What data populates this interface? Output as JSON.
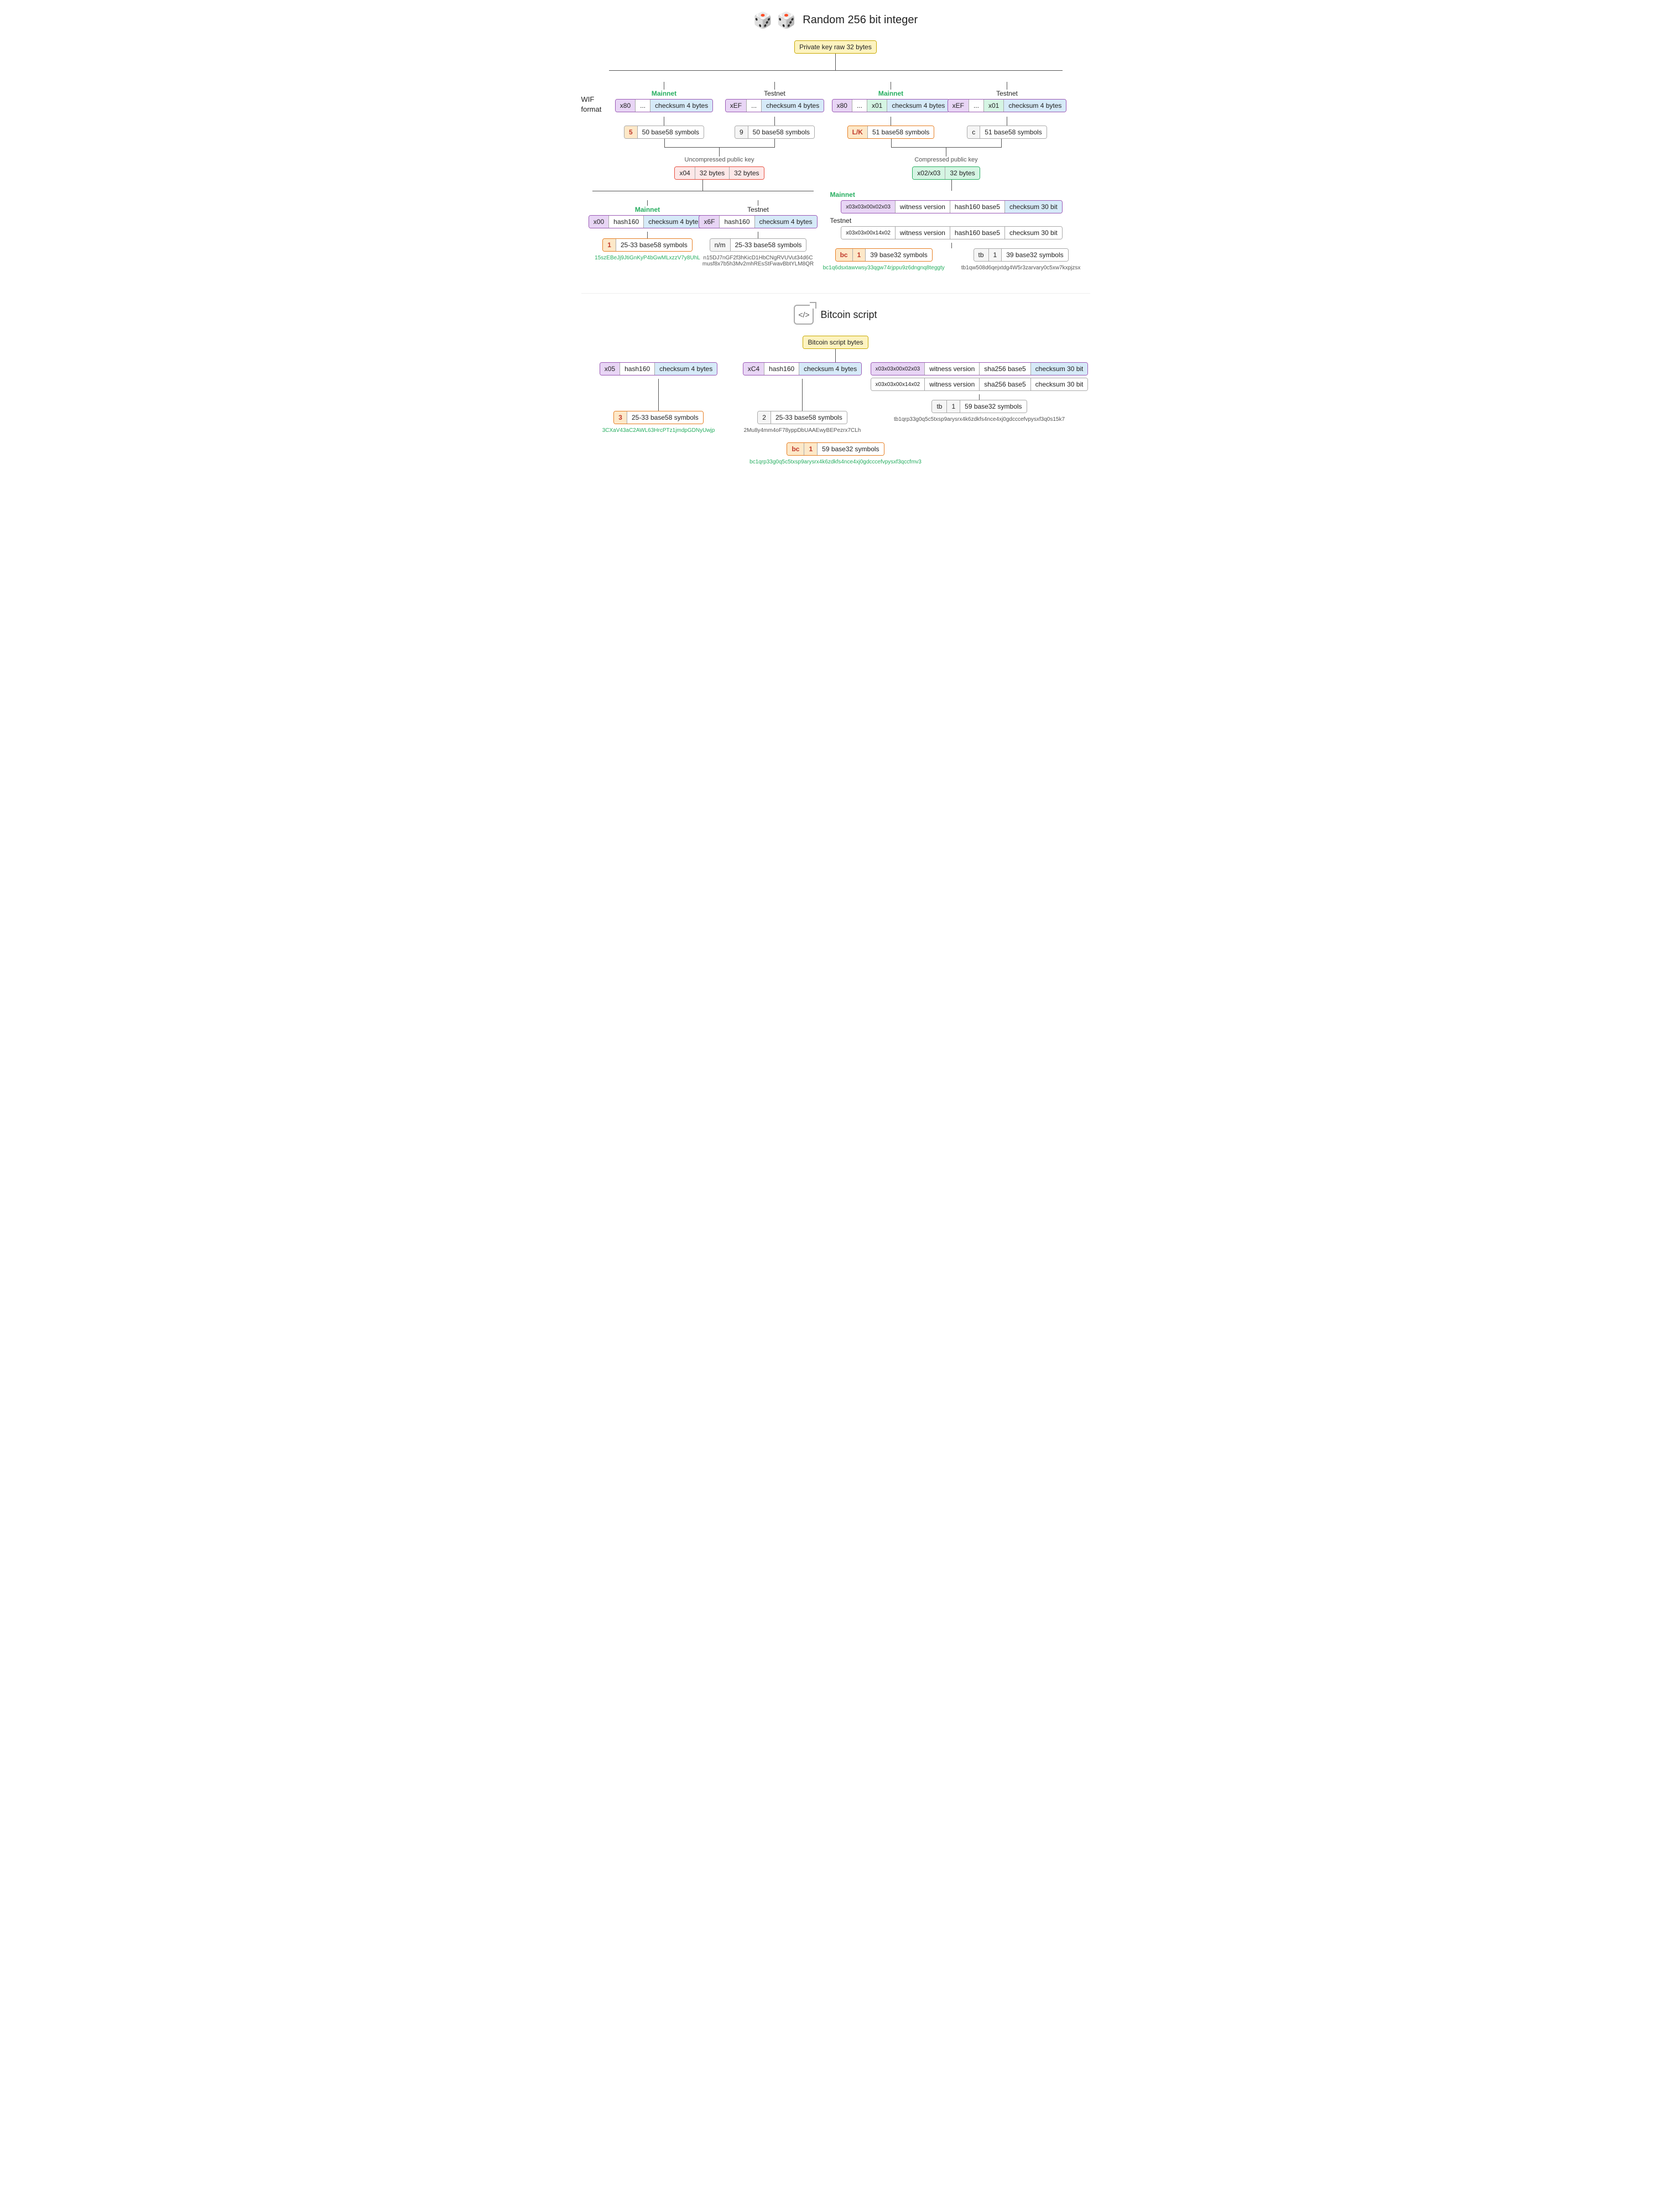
{
  "header": {
    "title": "Random 256 bit integer",
    "dice": "🎲🎲"
  },
  "top_node": {
    "label": "Private key raw 32 bytes"
  },
  "section1_title": "Bitcoin script",
  "section2_title": "Bitcoin script bytes",
  "branches": {
    "mainnet_uncompressed": {
      "net": "Mainnet",
      "bytes": [
        "x80",
        "...",
        "checksum 4 bytes"
      ]
    },
    "testnet_uncompressed": {
      "net": "Testnet",
      "bytes": [
        "xEF",
        "...",
        "checksum 4 bytes"
      ]
    },
    "mainnet_compressed": {
      "net": "Mainnet",
      "bytes": [
        "x80",
        "...",
        "x01",
        "checksum 4 bytes"
      ]
    },
    "testnet_compressed": {
      "net": "Testnet",
      "bytes": [
        "xEF",
        "...",
        "x01",
        "checksum 4 bytes"
      ]
    }
  },
  "wif": {
    "label": "WIF\nformat",
    "mainnet_uncomp": {
      "prefix": "5",
      "desc": "50 base58 symbols"
    },
    "testnet_uncomp": {
      "prefix": "9",
      "desc": "50 base58 symbols"
    },
    "mainnet_comp": {
      "prefix": "L/K",
      "desc": "51 base58 symbols"
    },
    "testnet_comp": {
      "prefix": "c",
      "desc": "51 base58 symbols"
    }
  },
  "pubkeys": {
    "uncompressed": {
      "label": "Uncompressed public key",
      "bytes": [
        "x04",
        "32 bytes",
        "32 bytes"
      ]
    },
    "compressed": {
      "label": "Compressed public key",
      "bytes": [
        "x02/x03",
        "32 bytes"
      ]
    }
  },
  "p2pkh": {
    "mainnet": {
      "net": "Mainnet",
      "bytes": [
        "x00",
        "hash160",
        "checksum 4 bytes"
      ],
      "wif_prefix": "1",
      "wif_desc": "25-33 base58 symbols",
      "address": "15szEBeJj9JtiGnKyP4bGwMLxzzV7y8UhL"
    },
    "testnet": {
      "net": "Testnet",
      "bytes": [
        "x6F",
        "hash160",
        "checksum 4 bytes"
      ],
      "wif_prefix": "n/m",
      "wif_desc": "25-33 base58 symbols",
      "address1": "n15DJ7nGF2f3hKicD1HbCNgRVUVut34d6C",
      "address2": "musf8x7b5h3Mv2mhREsStFwavBbtYLM8QR"
    }
  },
  "bech32": {
    "mainnet": {
      "bytes": [
        "x03x03x00x02x03",
        "witness version",
        "hash160 base5",
        "checksum 30 bit"
      ],
      "prefix": "bc",
      "num": "1",
      "desc": "39 base32 symbols",
      "address": "bc1q6dsxtawvwsy33qgw74rjppu9z6dngnq8teggty"
    },
    "testnet": {
      "bytes": [
        "x03x03x00x14x02",
        "witness version",
        "hash160 base5",
        "checksum 30 bit"
      ],
      "prefix": "tb",
      "num": "1",
      "desc": "39 base32 symbols",
      "address": "tb1qw508d6qejxtdg4W5r3zarvary0c5xw7kxpjzsx"
    }
  },
  "script_section": {
    "p2sh_mainnet": {
      "bytes": [
        "x05",
        "hash160",
        "checksum 4 bytes"
      ],
      "prefix": "3",
      "desc": "25-33 base58 symbols",
      "address": "3CXaV43aC2AWL63HrcPTz1jmdpGDNyUwjp"
    },
    "p2sh_testnet": {
      "bytes": [
        "xC4",
        "hash160",
        "checksum 4 bytes"
      ],
      "prefix": "2",
      "desc": "25-33 base58 symbols",
      "address": "2Mu8y4mm4oF78yppDbUAAEwyBEPezrx7CLh"
    },
    "p2wsh_mainnet": {
      "bytes": [
        "x03x03x00x02x03",
        "witness version",
        "sha256 base5",
        "checksum 30 bit"
      ],
      "prefix": "bc",
      "num": "1",
      "desc": "59 base32 symbols",
      "address": "bc1qrp33g0q5c5txsp9arysrx4k6zdkfs4nce4xj0gdcccefvpysxf3qccfmv3"
    },
    "p2wsh_testnet": {
      "bytes": [
        "x03x03x00x14x02",
        "witness version",
        "sha256 base5",
        "checksum 30 bit"
      ],
      "prefix": "tb",
      "num": "1",
      "desc": "59 base32 symbols",
      "address": "tb1qrp33g0q5c5txsp9arysrx4k6zdkfs4nce4xj0gdcccefvpysxf3q0s15k7"
    }
  }
}
